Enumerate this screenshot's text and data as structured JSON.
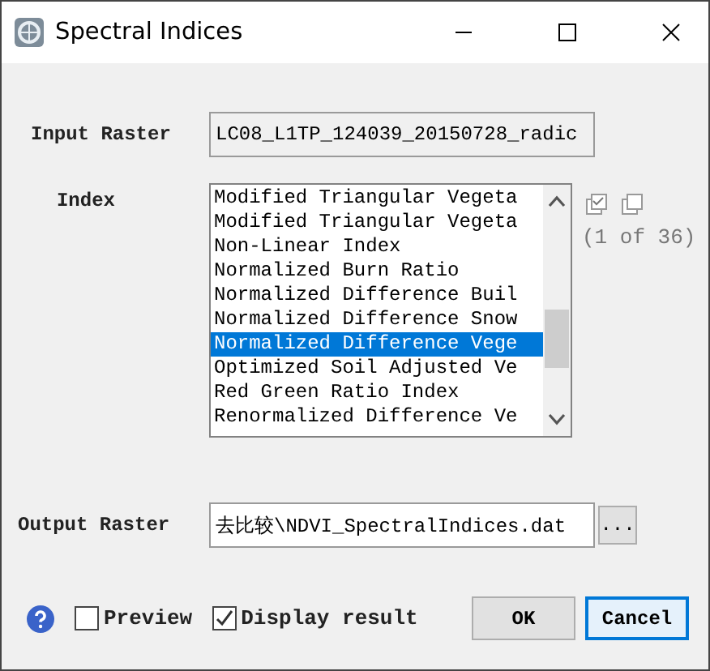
{
  "window": {
    "title": "Spectral Indices"
  },
  "input_raster": {
    "label": "Input Raster",
    "value": "LC08_L1TP_124039_20150728_radic"
  },
  "index": {
    "label": "Index",
    "count": "(1 of 36)",
    "items": [
      {
        "label": "Modified Triangular Vegeta",
        "selected": false
      },
      {
        "label": "Modified Triangular Vegeta",
        "selected": false
      },
      {
        "label": "Non-Linear Index",
        "selected": false
      },
      {
        "label": "Normalized Burn Ratio",
        "selected": false
      },
      {
        "label": "Normalized Difference Buil",
        "selected": false
      },
      {
        "label": "Normalized Difference Snow",
        "selected": false
      },
      {
        "label": "Normalized Difference Vege",
        "selected": true
      },
      {
        "label": "Optimized Soil Adjusted Ve",
        "selected": false
      },
      {
        "label": "Red Green Ratio Index",
        "selected": false
      },
      {
        "label": "Renormalized Difference Ve",
        "selected": false
      }
    ]
  },
  "output_raster": {
    "label": "Output Raster",
    "value": "去比较\\NDVI_SpectralIndices.dat",
    "browse": "..."
  },
  "preview": {
    "label": "Preview",
    "checked": false
  },
  "display_result": {
    "label": "Display result",
    "checked": true
  },
  "buttons": [
    {
      "label": "OK",
      "kind": "plain"
    },
    {
      "label": "Cancel",
      "kind": "default"
    }
  ]
}
